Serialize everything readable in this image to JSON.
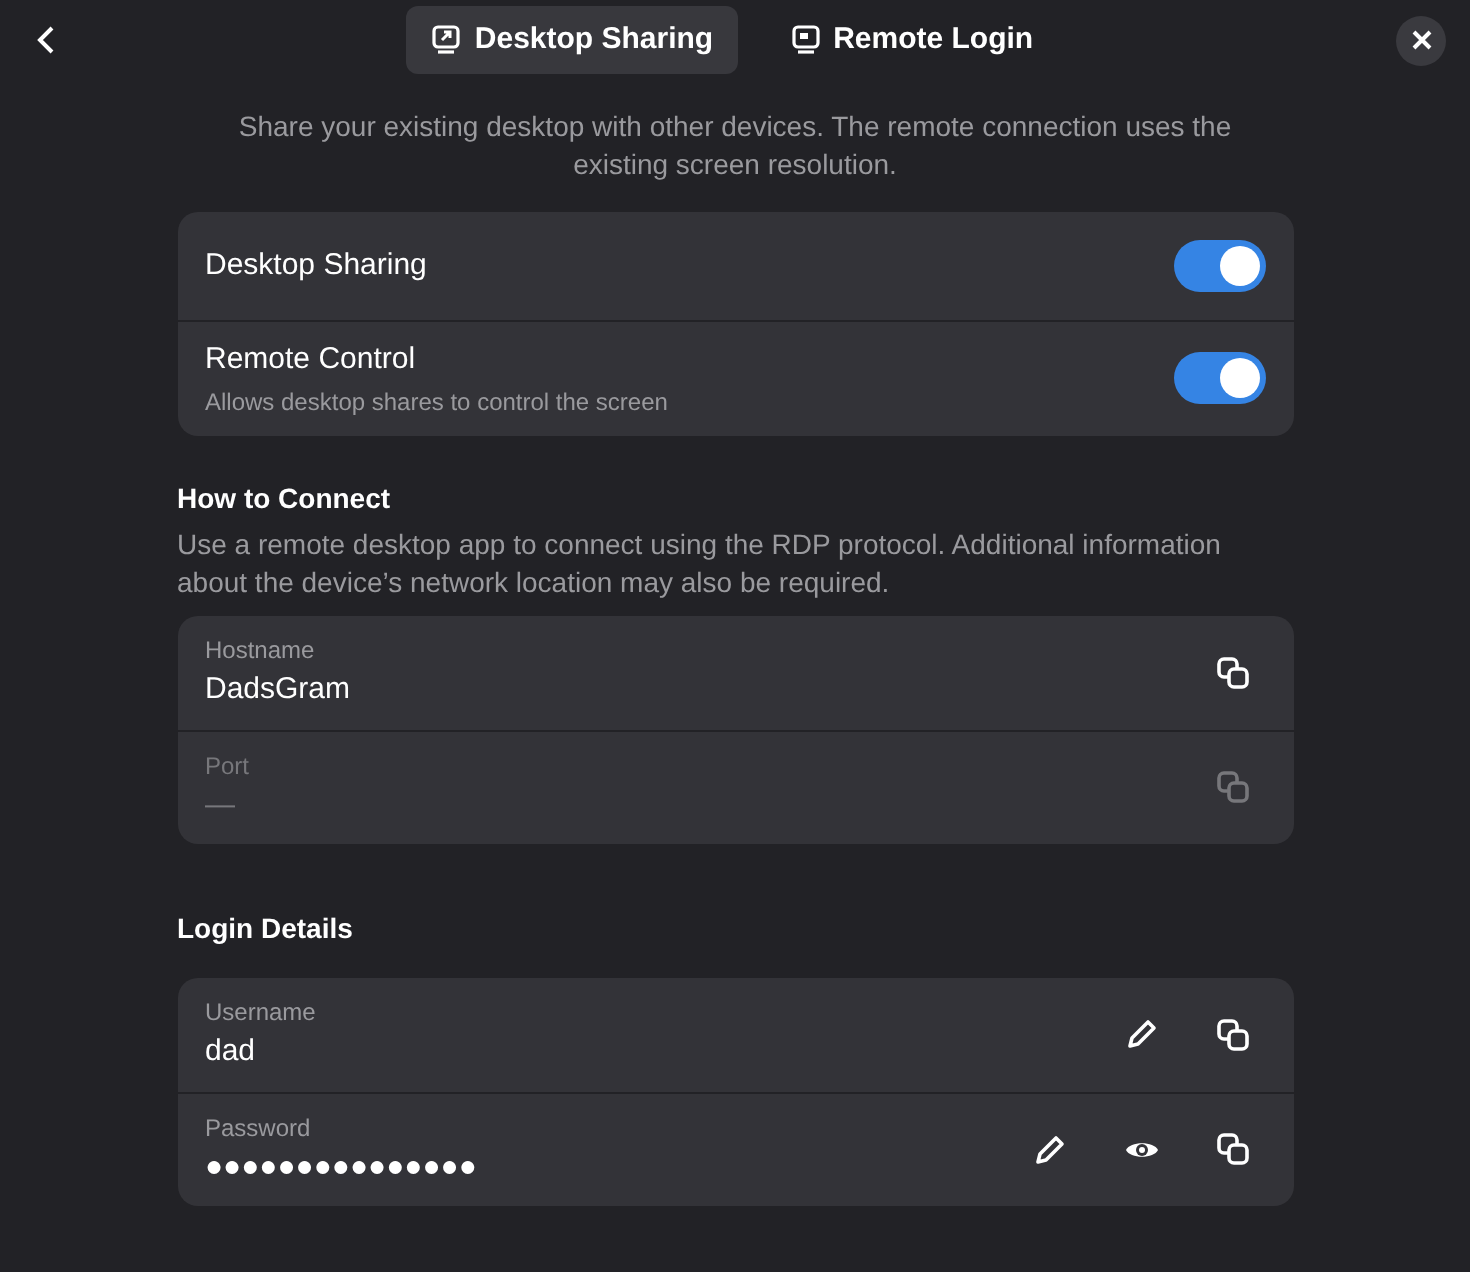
{
  "header": {
    "tabs": [
      {
        "label": "Desktop Sharing",
        "selected": true,
        "kind": "share"
      },
      {
        "label": "Remote Login",
        "selected": false,
        "kind": "login"
      }
    ]
  },
  "description": "Share your existing desktop with other devices. The remote connection uses the existing screen resolution.",
  "switches": [
    {
      "title": "Desktop Sharing",
      "on": true
    },
    {
      "title": "Remote Control",
      "subtitle": "Allows desktop shares to control the screen",
      "on": true
    }
  ],
  "sections": [
    {
      "title": "How to Connect",
      "description": "Use a remote desktop app to connect using the RDP protocol. Additional information about the device’s network location may also be required.",
      "rows": [
        {
          "label": "Hostname",
          "value": "DadsGram",
          "disabled": false,
          "actions": [
            {
              "kind": "copy"
            }
          ]
        },
        {
          "label": "Port",
          "value": "—",
          "disabled": true,
          "actions": [
            {
              "kind": "copy"
            }
          ]
        }
      ]
    },
    {
      "title": "Login Details",
      "rows": [
        {
          "label": "Username",
          "value": "dad",
          "disabled": false,
          "actions": [
            {
              "kind": "edit"
            },
            {
              "kind": "copy"
            }
          ]
        },
        {
          "label": "Password",
          "value": "●●●●●●●●●●●●●●●",
          "disabled": false,
          "actions": [
            {
              "kind": "edit"
            },
            {
              "kind": "reveal"
            },
            {
              "kind": "copy"
            }
          ]
        }
      ]
    }
  ]
}
